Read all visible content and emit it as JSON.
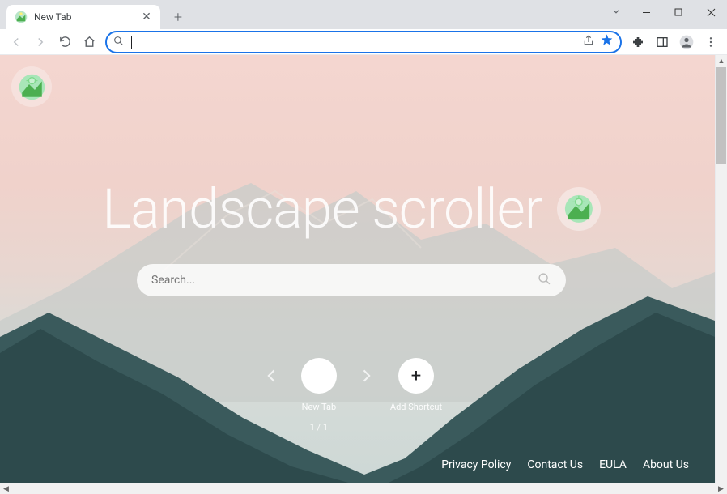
{
  "window": {
    "tab_title": "New Tab"
  },
  "omnibox": {
    "value": "",
    "placeholder": ""
  },
  "page": {
    "hero_title": "Landscape scroller",
    "search_placeholder": "Search...",
    "shortcuts": {
      "newtab_label": "New Tab",
      "add_label": "Add Shortcut",
      "pager": "1 / 1"
    },
    "footer": {
      "privacy": "Privacy Policy",
      "contact": "Contact Us",
      "eula": "EULA",
      "about": "About Us"
    }
  }
}
